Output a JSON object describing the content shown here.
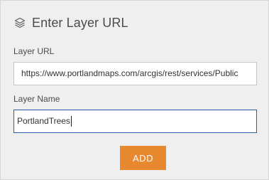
{
  "dialog": {
    "title": "Enter Layer URL",
    "icon": "layers-icon"
  },
  "fields": {
    "url": {
      "label": "Layer URL",
      "value": "https://www.portlandmaps.com/arcgis/rest/services/Public"
    },
    "name": {
      "label": "Layer Name",
      "value": "PortlandTrees"
    }
  },
  "actions": {
    "add_label": "ADD"
  },
  "colors": {
    "accent": "#e8882f",
    "panel_bg": "#efefef",
    "focus_border": "#2a5ea8"
  }
}
